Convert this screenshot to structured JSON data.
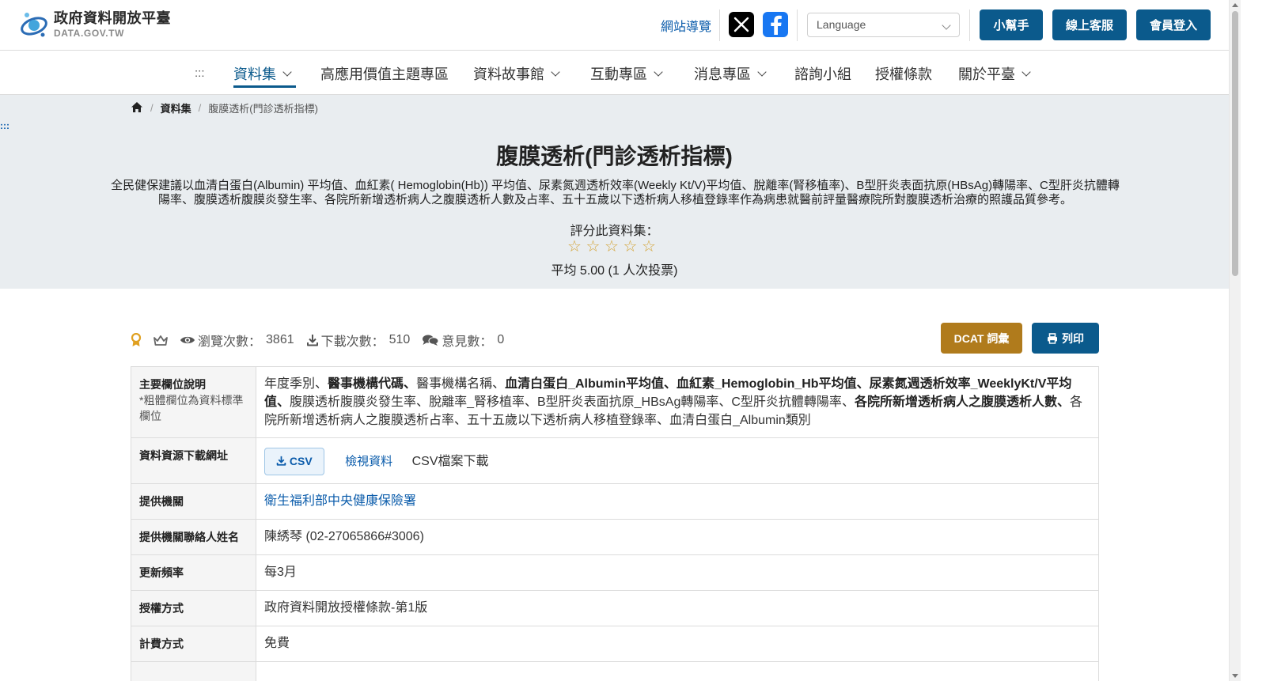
{
  "header": {
    "logo_title": "政府資料開放平臺",
    "logo_sub": "DATA.GOV.TW",
    "sitemap": "網站導覽",
    "language_placeholder": "Language",
    "buttons": {
      "helper": "小幫手",
      "service": "線上客服",
      "login": "會員登入"
    }
  },
  "nav": {
    "menu_icon": ":::",
    "items": [
      "資料集",
      "高應用價值主題專區",
      "資料故事館",
      "互動專區",
      "消息專區",
      "諮詢小組",
      "授權條款",
      "關於平臺"
    ]
  },
  "breadcrumb": {
    "level1": "資料集",
    "current": "腹膜透析(門診透析指標)"
  },
  "skip_mark": ":::",
  "dataset": {
    "title": "腹膜透析(門診透析指標)",
    "description": "全民健保建議以血清白蛋白(Albumin) 平均值、血紅素( Hemoglobin(Hb)) 平均值、尿素氮週透析效率(Weekly Kt/V)平均值、脫離率(腎移植率)、B型肝炎表面抗原(HBsAg)轉陽率、C型肝炎抗體轉陽率、腹膜透析腹膜炎發生率、各院所新增透析病人之腹膜透析人數及占率、五十五歲以下透析病人移植登錄率作為病患就醫前評量醫療院所對腹膜透析治療的照護品質參考。",
    "rate_label": "評分此資料集：",
    "rating_stars": 5,
    "rate_avg": "平均 5.00 (1 人次投票)"
  },
  "stats": {
    "views_label": "瀏覽次數：",
    "views": "3861",
    "downloads_label": "下載次數：",
    "downloads": "510",
    "comments_label": "意見數：",
    "comments": "0"
  },
  "actions": {
    "dcat": "DCAT 詞彙",
    "print": "列印"
  },
  "table": {
    "fields_label": "主要欄位說明",
    "fields_note": "*粗體欄位為資料標準欄位",
    "fields": [
      {
        "text": "年度季別",
        "bold": false
      },
      {
        "text": "醫事機構代碼",
        "bold": true
      },
      {
        "text": "醫事機構名稱",
        "bold": false
      },
      {
        "text": "血清白蛋白_Albumin平均值",
        "bold": true
      },
      {
        "text": "血紅素_Hemoglobin_Hb平均值",
        "bold": true
      },
      {
        "text": "尿素氮週透析效率_WeeklyKt/V平均值",
        "bold": true
      },
      {
        "text": "腹膜透析腹膜炎發生率",
        "bold": false
      },
      {
        "text": "脫離率_腎移植率",
        "bold": false
      },
      {
        "text": "B型肝炎表面抗原_HBsAg轉陽率",
        "bold": false
      },
      {
        "text": "C型肝炎抗體轉陽率",
        "bold": false
      },
      {
        "text": "各院所新增透析病人之腹膜透析人數",
        "bold": true
      },
      {
        "text": "各院所新增透析病人之腹膜透析占率",
        "bold": false
      },
      {
        "text": "五十五歲以下透析病人移植登錄率",
        "bold": false
      },
      {
        "text": "血清白蛋白_Albumin類別",
        "bold": false
      }
    ],
    "download_label": "資料資源下載網址",
    "csv_button": "CSV",
    "view_data": "檢視資料",
    "csv_desc": "CSV檔案下載",
    "provider_label": "提供機關",
    "provider": "衛生福利部中央健康保險署",
    "contact_label": "提供機關聯絡人姓名",
    "contact": "陳綉琴 (02-27065866#3006)",
    "frequency_label": "更新頻率",
    "frequency": "每3月",
    "license_label": "授權方式",
    "license": "政府資料開放授權條款-第1版",
    "fee_label": "計費方式",
    "fee": "免費"
  },
  "colors": {
    "primary": "#0b5a8c",
    "dcat": "#b07b1c",
    "star": "#d4a53a",
    "hero_bg": "#e9edf0"
  }
}
